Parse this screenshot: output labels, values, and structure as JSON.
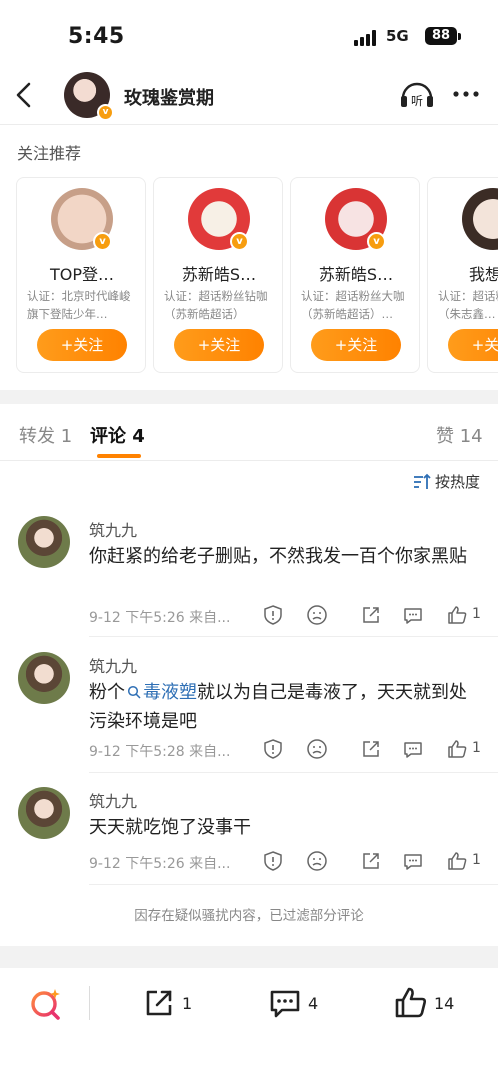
{
  "status_bar": {
    "time": "5:45",
    "network": "5G",
    "battery": "88"
  },
  "header": {
    "title": "玫瑰鉴赏期"
  },
  "recommendations": {
    "title": "关注推荐",
    "follow_label": "+关注",
    "cards": [
      {
        "name": "TOP登…",
        "desc": "认证：北京时代峰峻旗下登陆少年…"
      },
      {
        "name": "苏新皓S…",
        "desc": "认证：超话粉丝钻咖（苏新皓超话）"
      },
      {
        "name": "苏新皓S…",
        "desc": "认证：超话粉丝大咖（苏新皓超话）…"
      },
      {
        "name": "我想你",
        "desc": "认证：超话粉丝大咖（朱志鑫…"
      }
    ]
  },
  "tabs": {
    "repost": "转发 1",
    "comments": "评论 4",
    "likes": "赞 14"
  },
  "sort": {
    "label": "按热度"
  },
  "comments": [
    {
      "name": "筑九九",
      "text": "你赶紧的给老子删贴，不然我发一百个你家黑贴",
      "meta": "9-12  下午5:26  来自...",
      "likes": "1"
    },
    {
      "name": "筑九九",
      "text_before": "粉个",
      "tag": "毒液塑",
      "text_after": "就以为自己是毒液了，天天就到处污染环境是吧",
      "meta": "9-12  下午5:28  来自...",
      "likes": "1"
    },
    {
      "name": "筑九九",
      "text": "天天就吃饱了没事干",
      "meta": "9-12  下午5:26  来自...",
      "likes": "1"
    }
  ],
  "filter_note": "因存在疑似骚扰内容，已过滤部分评论",
  "bottom_bar": {
    "repost_count": "1",
    "comment_count": "4",
    "like_count": "14"
  },
  "colors": {
    "accent": "#ff8200",
    "link": "#2e6fb5",
    "verified": "#f79d0f"
  },
  "icons": [
    "back-icon",
    "listen-icon",
    "more-icon",
    "sort-icon",
    "report-icon",
    "dislike-icon",
    "share-icon",
    "comment-icon",
    "like-icon",
    "search-icon"
  ]
}
